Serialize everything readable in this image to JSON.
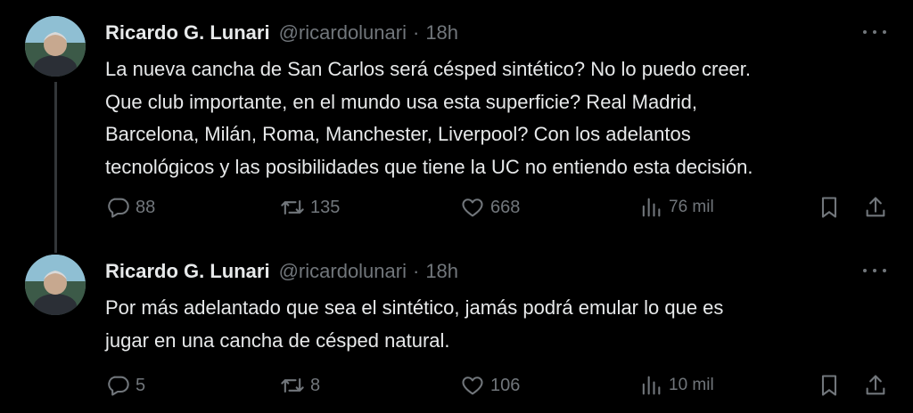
{
  "tweets": [
    {
      "author": {
        "name": "Ricardo G. Lunari",
        "handle": "@ricardolunari"
      },
      "separator": "·",
      "time": "18h",
      "text_lines": [
        "La nueva cancha de San Carlos será césped sintético? No lo puedo creer.",
        "Que club importante, en el mundo usa esta superficie? Real Madrid,",
        "Barcelona, Milán, Roma, Manchester, Liverpool? Con los adelantos",
        "tecnológicos y las posibilidades que tiene la UC no entiendo esta decisión."
      ],
      "stats": {
        "replies": "88",
        "retweets": "135",
        "likes": "668",
        "views": "76 mil"
      }
    },
    {
      "author": {
        "name": "Ricardo G. Lunari",
        "handle": "@ricardolunari"
      },
      "separator": "·",
      "time": "18h",
      "text_lines": [
        "Por más adelantado que sea el sintético, jamás podrá emular lo que es",
        "jugar en una cancha de césped natural."
      ],
      "stats": {
        "replies": "5",
        "retweets": "8",
        "likes": "106",
        "views": "10 mil"
      }
    }
  ],
  "icons": [
    "reply-icon",
    "retweet-icon",
    "like-icon",
    "views-icon",
    "bookmark-icon",
    "share-icon",
    "more-icon"
  ],
  "colors": {
    "background": "#000000",
    "text": "#e7e9ea",
    "secondary": "#71767b",
    "thread_line": "#333639"
  }
}
